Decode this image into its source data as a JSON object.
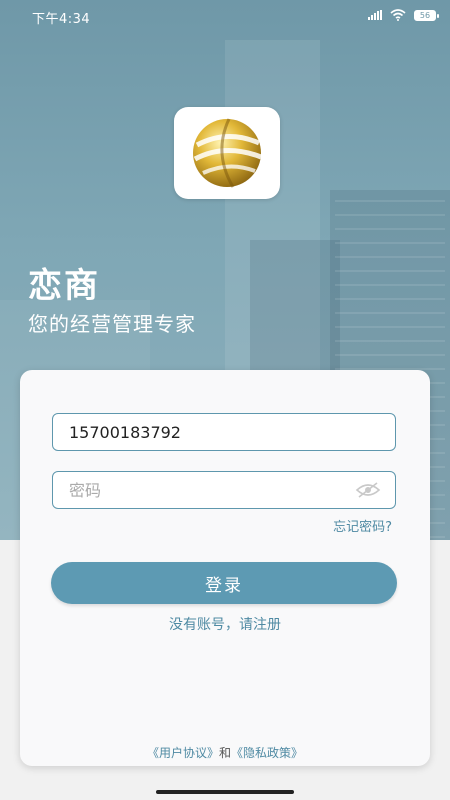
{
  "status_bar": {
    "time": "下午4:34",
    "battery": "56"
  },
  "app": {
    "title": "恋商",
    "slogan": "您的经营管理专家"
  },
  "login_form": {
    "phone_value": "15700183792",
    "password_placeholder": "密码",
    "forgot_password": "忘记密码?",
    "login_button": "登录",
    "register_link": "没有账号，请注册"
  },
  "agreement": {
    "user_agreement": "《用户协议》",
    "conjunction": "和",
    "privacy_policy": "《隐私政策》"
  },
  "colors": {
    "accent": "#5d9ab3",
    "link": "#4f8aa3",
    "hero_bg": "#7fa7b5",
    "logo_gold": "#c9a227"
  },
  "icons": {
    "logo": "gold-globe-logo-icon",
    "password_toggle": "eye-slash-icon",
    "signal": "signal-icon",
    "wifi": "wifi-icon",
    "battery": "battery-icon"
  }
}
